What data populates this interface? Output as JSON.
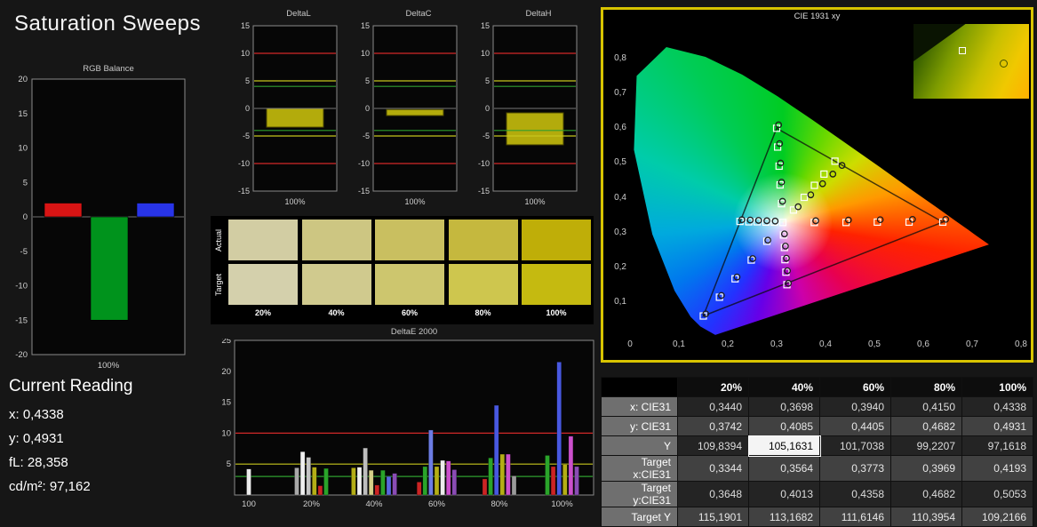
{
  "page": {
    "title": "Saturation Sweeps"
  },
  "current_reading": {
    "title": "Current Reading",
    "lines": [
      "x: 0,4338",
      "y: 0,4931",
      "fL: 28,358",
      "cd/m²: 97,162"
    ]
  },
  "chart_data": [
    {
      "id": "rgb_balance",
      "type": "bar",
      "title": "RGB Balance",
      "ylim": [
        -20,
        20
      ],
      "yticks": [
        -20,
        -15,
        -10,
        -5,
        0,
        5,
        10,
        15,
        20
      ],
      "xlabel": "100%",
      "categories": [
        "Red",
        "Green",
        "Blue"
      ],
      "values": [
        2,
        -15,
        2
      ],
      "colors": [
        "#d81414",
        "#00931c",
        "#2834e8"
      ]
    },
    {
      "id": "delta_l",
      "type": "bar",
      "title": "DeltaL",
      "ylim": [
        -15,
        15
      ],
      "yticks": [
        -15,
        -10,
        -5,
        0,
        5,
        10,
        15
      ],
      "xlabel": "100%",
      "bar": {
        "from": 0,
        "to": -3.4
      },
      "bar_color": "#b3ab0c",
      "ref_lines": [
        {
          "value": 10,
          "color": "#d22828"
        },
        {
          "value": -10,
          "color": "#d22828"
        },
        {
          "value": 5,
          "color": "#c6c61e"
        },
        {
          "value": -5,
          "color": "#c6c61e"
        },
        {
          "value": 4,
          "color": "#2f9e2f"
        },
        {
          "value": -4,
          "color": "#2f9e2f"
        }
      ]
    },
    {
      "id": "delta_c",
      "type": "bar",
      "title": "DeltaC",
      "ylim": [
        -15,
        15
      ],
      "yticks": [
        -15,
        -10,
        -5,
        0,
        5,
        10,
        15
      ],
      "xlabel": "100%",
      "bar": {
        "from": -0.2,
        "to": -1.3
      },
      "bar_color": "#b3ab0c",
      "ref_lines": [
        {
          "value": 10,
          "color": "#d22828"
        },
        {
          "value": -10,
          "color": "#d22828"
        },
        {
          "value": 5,
          "color": "#c6c61e"
        },
        {
          "value": -5,
          "color": "#c6c61e"
        },
        {
          "value": 4,
          "color": "#2f9e2f"
        },
        {
          "value": -4,
          "color": "#2f9e2f"
        }
      ]
    },
    {
      "id": "delta_h",
      "type": "bar",
      "title": "DeltaH",
      "ylim": [
        -15,
        15
      ],
      "yticks": [
        -15,
        -10,
        -5,
        0,
        5,
        10,
        15
      ],
      "xlabel": "100%",
      "bar": {
        "from": -0.8,
        "to": -6.6
      },
      "bar_color": "#b3ab0c",
      "ref_lines": [
        {
          "value": 10,
          "color": "#d22828"
        },
        {
          "value": -10,
          "color": "#d22828"
        },
        {
          "value": 5,
          "color": "#c6c61e"
        },
        {
          "value": -5,
          "color": "#c6c61e"
        },
        {
          "value": 4,
          "color": "#2f9e2f"
        },
        {
          "value": -4,
          "color": "#2f9e2f"
        }
      ]
    },
    {
      "id": "deltae_2000",
      "type": "bar",
      "title": "DeltaE 2000",
      "ylim": [
        0,
        25
      ],
      "yticks": [
        5,
        10,
        15,
        20,
        25
      ],
      "ref_lines": [
        {
          "value": 10,
          "color": "#d22828"
        },
        {
          "value": 5,
          "color": "#c6c61e"
        },
        {
          "value": 3,
          "color": "#2f9e2f"
        }
      ],
      "groups": [
        {
          "label": "100",
          "bars": [
            {
              "color": "#ececec",
              "value": 4.2
            }
          ]
        },
        {
          "label": "20%",
          "bars": [
            {
              "color": "#a8a8a8",
              "value": 4.4
            },
            {
              "color": "#f0f0f0",
              "value": 7.0
            },
            {
              "color": "#c4c4c4",
              "value": 6.1
            },
            {
              "color": "#b4ae16",
              "value": 4.5
            },
            {
              "color": "#cc2424",
              "value": 1.5
            },
            {
              "color": "#2aa42a",
              "value": 4.3
            }
          ]
        },
        {
          "label": "40%",
          "bars": [
            {
              "color": "#b4ae16",
              "value": 4.4
            },
            {
              "color": "#f0f0f0",
              "value": 4.5
            },
            {
              "color": "#bdbdbd",
              "value": 7.6
            },
            {
              "color": "#d6d088",
              "value": 4.0
            },
            {
              "color": "#cc2424",
              "value": 1.6
            },
            {
              "color": "#2aa42a",
              "value": 4.0
            },
            {
              "color": "#5868e0",
              "value": 3.0
            },
            {
              "color": "#8a4cb4",
              "value": 3.5
            }
          ]
        },
        {
          "label": "60%",
          "bars": [
            {
              "color": "#cc2424",
              "value": 2.1
            },
            {
              "color": "#2aa42a",
              "value": 4.6
            },
            {
              "color": "#6c7ce4",
              "value": 10.5
            },
            {
              "color": "#b4ae16",
              "value": 4.6
            },
            {
              "color": "#ececec",
              "value": 5.6
            },
            {
              "color": "#cc50cc",
              "value": 5.5
            },
            {
              "color": "#8a4cb4",
              "value": 4.1
            }
          ]
        },
        {
          "label": "80%",
          "bars": [
            {
              "color": "#cc2424",
              "value": 2.6
            },
            {
              "color": "#2aa42a",
              "value": 6.0
            },
            {
              "color": "#4858e0",
              "value": 14.5
            },
            {
              "color": "#b4ae16",
              "value": 6.6
            },
            {
              "color": "#cc50cc",
              "value": 6.6
            },
            {
              "color": "#9a9a9a",
              "value": 3.1
            }
          ]
        },
        {
          "label": "100%",
          "bars": [
            {
              "color": "#2aa42a",
              "value": 6.4
            },
            {
              "color": "#cc2424",
              "value": 4.6
            },
            {
              "color": "#4858e0",
              "value": 21.5
            },
            {
              "color": "#b4ae16",
              "value": 5.0
            },
            {
              "color": "#cc50cc",
              "value": 9.5
            },
            {
              "color": "#8a4cb4",
              "value": 4.6
            }
          ]
        }
      ]
    },
    {
      "id": "cie_1931",
      "type": "scatter",
      "title": "CIE 1931 xy",
      "xlim": [
        0,
        0.8
      ],
      "ylim": [
        0,
        0.9
      ],
      "xticks": [
        {
          "label": "0",
          "value": 0
        },
        {
          "label": "0,1",
          "value": 0.1
        },
        {
          "label": "0,2",
          "value": 0.2
        },
        {
          "label": "0,3",
          "value": 0.3
        },
        {
          "label": "0,4",
          "value": 0.4
        },
        {
          "label": "0,5",
          "value": 0.5
        },
        {
          "label": "0,6",
          "value": 0.6
        },
        {
          "label": "0,7",
          "value": 0.7
        },
        {
          "label": "0,8",
          "value": 0.8
        }
      ],
      "yticks": [
        {
          "label": "0,1",
          "value": 0.1
        },
        {
          "label": "0,2",
          "value": 0.2
        },
        {
          "label": "0,3",
          "value": 0.3
        },
        {
          "label": "0,4",
          "value": 0.4
        },
        {
          "label": "0,5",
          "value": 0.5
        },
        {
          "label": "0,6",
          "value": 0.6
        },
        {
          "label": "0,7",
          "value": 0.7
        },
        {
          "label": "0,8",
          "value": 0.8
        }
      ],
      "gamut_triangle": [
        [
          0.64,
          0.33
        ],
        [
          0.3,
          0.6
        ],
        [
          0.15,
          0.06
        ]
      ],
      "white_point": [
        0.3127,
        0.329
      ],
      "targets": [
        [
          0.3127,
          0.329
        ],
        [
          0.377,
          0.329
        ],
        [
          0.442,
          0.329
        ],
        [
          0.506,
          0.33
        ],
        [
          0.571,
          0.33
        ],
        [
          0.64,
          0.33
        ],
        [
          0.31,
          0.383
        ],
        [
          0.307,
          0.437
        ],
        [
          0.305,
          0.491
        ],
        [
          0.302,
          0.546
        ],
        [
          0.3,
          0.6
        ],
        [
          0.28,
          0.275
        ],
        [
          0.248,
          0.221
        ],
        [
          0.215,
          0.167
        ],
        [
          0.183,
          0.114
        ],
        [
          0.15,
          0.06
        ],
        [
          0.295,
          0.33
        ],
        [
          0.278,
          0.33
        ],
        [
          0.26,
          0.331
        ],
        [
          0.243,
          0.331
        ],
        [
          0.225,
          0.332
        ],
        [
          0.314,
          0.293
        ],
        [
          0.316,
          0.257
        ],
        [
          0.317,
          0.222
        ],
        [
          0.319,
          0.186
        ],
        [
          0.321,
          0.15
        ],
        [
          0.3344,
          0.3648
        ],
        [
          0.3564,
          0.4013
        ],
        [
          0.3773,
          0.4358
        ],
        [
          0.3969,
          0.4682
        ],
        [
          0.4193,
          0.5053
        ]
      ],
      "measurements": [
        [
          0.344,
          0.3742
        ],
        [
          0.3698,
          0.4085
        ],
        [
          0.394,
          0.4405
        ],
        [
          0.415,
          0.4682
        ],
        [
          0.4338,
          0.4931
        ],
        [
          0.38,
          0.334
        ],
        [
          0.447,
          0.336
        ],
        [
          0.512,
          0.337
        ],
        [
          0.578,
          0.338
        ],
        [
          0.646,
          0.338
        ],
        [
          0.312,
          0.39
        ],
        [
          0.31,
          0.445
        ],
        [
          0.308,
          0.5
        ],
        [
          0.306,
          0.556
        ],
        [
          0.304,
          0.61
        ],
        [
          0.282,
          0.278
        ],
        [
          0.251,
          0.225
        ],
        [
          0.219,
          0.172
        ],
        [
          0.187,
          0.119
        ],
        [
          0.155,
          0.066
        ],
        [
          0.297,
          0.333
        ],
        [
          0.28,
          0.334
        ],
        [
          0.263,
          0.335
        ],
        [
          0.246,
          0.336
        ],
        [
          0.229,
          0.337
        ],
        [
          0.316,
          0.296
        ],
        [
          0.318,
          0.261
        ],
        [
          0.32,
          0.226
        ],
        [
          0.322,
          0.19
        ],
        [
          0.324,
          0.154
        ]
      ]
    }
  ],
  "cie_inset": {
    "square_pos": [
      0.42,
      0.36
    ],
    "circle_pos": [
      0.78,
      0.52
    ]
  },
  "swatches": {
    "row_labels": [
      "Actual",
      "Target"
    ],
    "col_labels": [
      "20%",
      "40%",
      "60%",
      "80%",
      "100%"
    ],
    "actual_colors": [
      "#d2cda3",
      "#cdc682",
      "#c9bf60",
      "#c5b83e",
      "#bfae08"
    ],
    "target_colors": [
      "#d4d0ac",
      "#d0ca8e",
      "#cdc66e",
      "#cec64e",
      "#c5ba10"
    ]
  },
  "table": {
    "headers": [
      "",
      "20%",
      "40%",
      "60%",
      "80%",
      "100%"
    ],
    "rows": [
      {
        "label": "x: CIE31",
        "values": [
          "0,3440",
          "0,3698",
          "0,3940",
          "0,4150",
          "0,4338"
        ]
      },
      {
        "label": "y: CIE31",
        "values": [
          "0,3742",
          "0,4085",
          "0,4405",
          "0,4682",
          "0,4931"
        ]
      },
      {
        "label": "Y",
        "values": [
          "109,8394",
          "105,1631",
          "101,7038",
          "99,2207",
          "97,1618"
        ]
      },
      {
        "label": "Target x:CIE31",
        "values": [
          "0,3344",
          "0,3564",
          "0,3773",
          "0,3969",
          "0,4193"
        ]
      },
      {
        "label": "Target y:CIE31",
        "values": [
          "0,3648",
          "0,4013",
          "0,4358",
          "0,4682",
          "0,5053"
        ]
      },
      {
        "label": "Target Y",
        "values": [
          "115,1901",
          "113,1682",
          "111,6146",
          "110,3954",
          "109,2166"
        ]
      }
    ],
    "highlight": {
      "row": 2,
      "col": 1
    }
  }
}
